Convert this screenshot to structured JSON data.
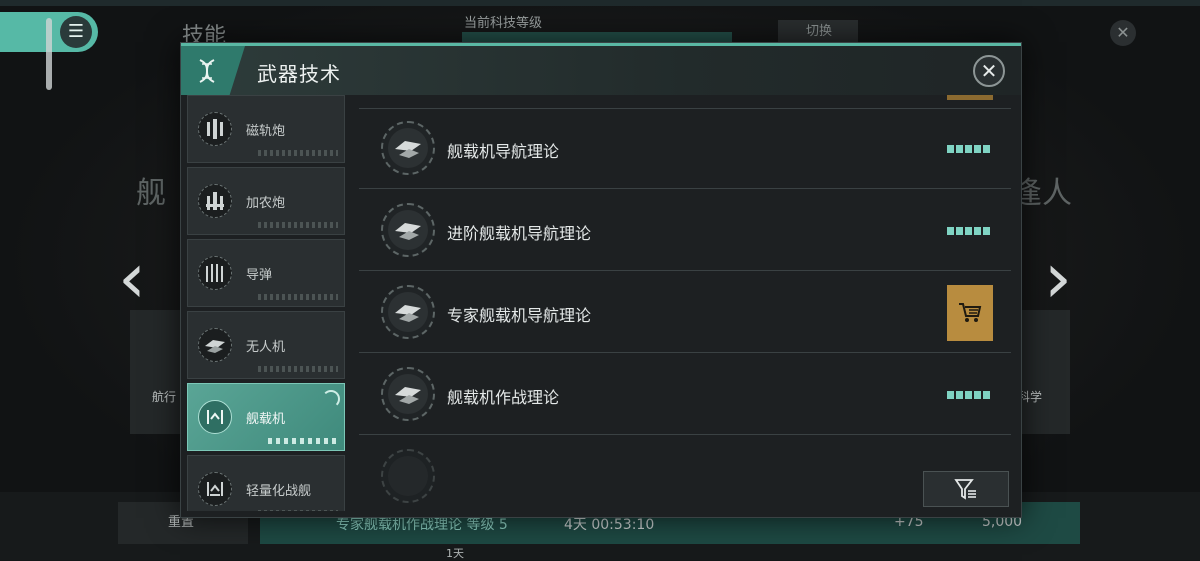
{
  "background": {
    "skill_title": "技能",
    "tech_level_label": "当前科技等级",
    "switch_label": "切换",
    "ship_left_char": "舰",
    "ship_right_chars": "逢人",
    "card_left_text": "航行",
    "card_right_text": "科学",
    "reset_label": "重置",
    "queue_text": "专家舰载机作战理论 等级 5",
    "queue_time": "4天 00:53:10",
    "bonus": "+75",
    "cost": "5,000",
    "duration": "1天"
  },
  "modal": {
    "title": "武器技术",
    "close_icon": "close-icon"
  },
  "categories": [
    {
      "label": "磁轨炮",
      "icon": "railgun-icon",
      "active": false
    },
    {
      "label": "加农炮",
      "icon": "cannon-icon",
      "active": false
    },
    {
      "label": "导弹",
      "icon": "missile-icon",
      "active": false
    },
    {
      "label": "无人机",
      "icon": "drone-icon",
      "active": false
    },
    {
      "label": "舰载机",
      "icon": "carrier-aircraft-icon",
      "active": true
    },
    {
      "label": "轻量化战舰",
      "icon": "light-warship-icon",
      "active": false
    }
  ],
  "techs": [
    {
      "name": "舰载机导航理论",
      "status": "maxed"
    },
    {
      "name": "进阶舰载机导航理论",
      "status": "maxed"
    },
    {
      "name": "专家舰载机导航理论",
      "status": "purchase"
    },
    {
      "name": "舰载机作战理论",
      "status": "maxed"
    }
  ],
  "colors": {
    "accent": "#5ab8a4",
    "purchase": "#b88c3f",
    "level_pips": "#7fd3c3"
  }
}
